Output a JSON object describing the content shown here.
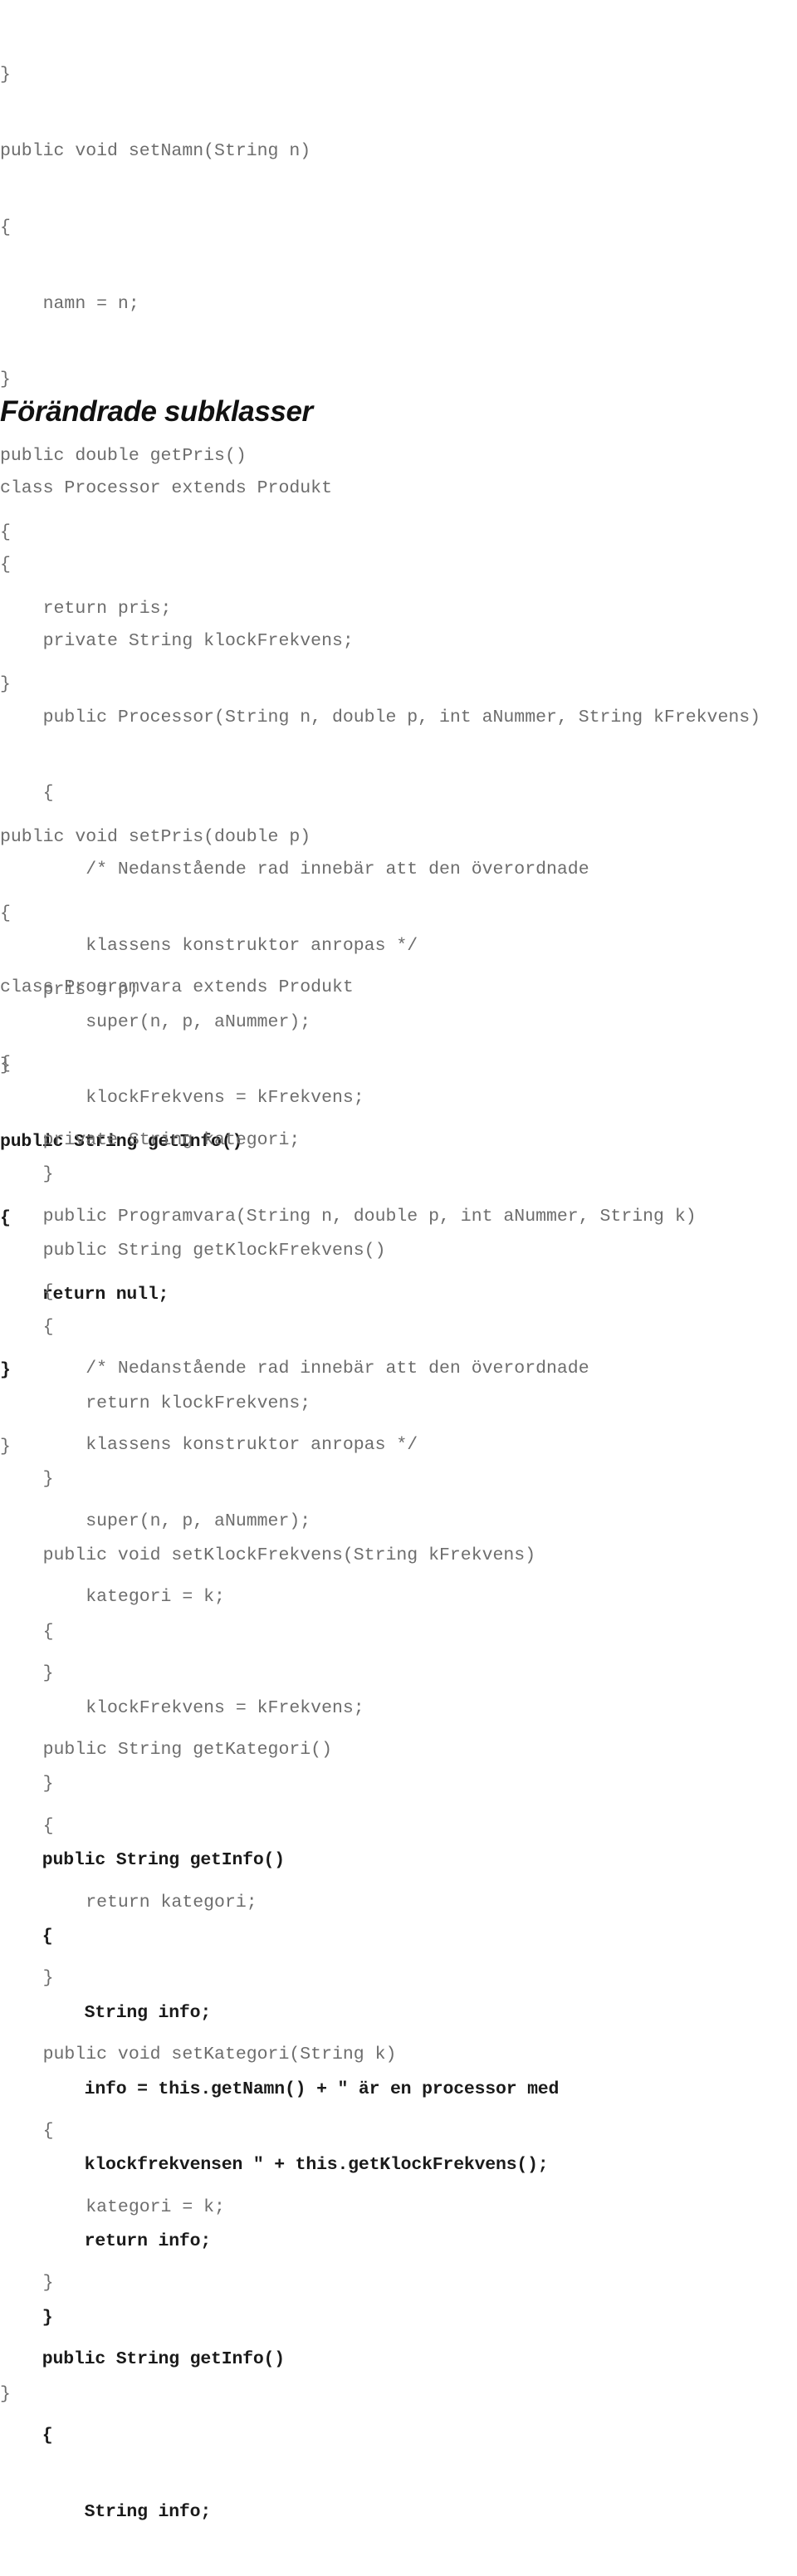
{
  "document": {
    "language": "sv",
    "kind": "java-code-listing"
  },
  "top_block": {
    "name": "produkt-class-tail",
    "lines": [
      {
        "text": "}",
        "bold": false
      },
      {
        "text": "public void setNamn(String n)",
        "bold": false
      },
      {
        "text": "{",
        "bold": false
      },
      {
        "text": "    namn = n;",
        "bold": false
      },
      {
        "text": "}",
        "bold": false
      },
      {
        "text": "public double getPris()",
        "bold": false
      },
      {
        "text": "{",
        "bold": false
      },
      {
        "text": "    return pris;",
        "bold": false
      },
      {
        "text": "}",
        "bold": false
      },
      {
        "text": "",
        "bold": false
      },
      {
        "text": "public void setPris(double p)",
        "bold": false
      },
      {
        "text": "{",
        "bold": false
      },
      {
        "text": "    pris = p;",
        "bold": false
      },
      {
        "text": "}",
        "bold": false
      },
      {
        "text": "public String getInfo()",
        "bold": true
      },
      {
        "text": "{",
        "bold": true
      },
      {
        "text": "    return null;",
        "bold": true
      },
      {
        "text": "}",
        "bold": true
      }
    ],
    "closing_brace": "}"
  },
  "heading": {
    "text": "Förändrade subklasser"
  },
  "processor_block": {
    "name": "processor-class",
    "lines": [
      {
        "text": "class Processor extends Produkt",
        "bold": false
      },
      {
        "text": "{",
        "bold": false
      },
      {
        "text": "    private String klockFrekvens;",
        "bold": false
      },
      {
        "text": "    public Processor(String n, double p, int aNummer, String kFrekvens)",
        "bold": false
      },
      {
        "text": "    {",
        "bold": false
      },
      {
        "text": "        /* Nedanstående rad innebär att den överordnade",
        "bold": false
      },
      {
        "text": "        klassens konstruktor anropas */",
        "bold": false
      },
      {
        "text": "        super(n, p, aNummer);",
        "bold": false
      },
      {
        "text": "        klockFrekvens = kFrekvens;",
        "bold": false
      },
      {
        "text": "    }",
        "bold": false
      },
      {
        "text": "    public String getKlockFrekvens()",
        "bold": false
      },
      {
        "text": "    {",
        "bold": false
      },
      {
        "text": "        return klockFrekvens;",
        "bold": false
      },
      {
        "text": "    }",
        "bold": false
      },
      {
        "text": "    public void setKlockFrekvens(String kFrekvens)",
        "bold": false
      },
      {
        "text": "    {",
        "bold": false
      },
      {
        "text": "        klockFrekvens = kFrekvens;",
        "bold": false
      },
      {
        "text": "    }",
        "bold": false
      },
      {
        "text": "    public String getInfo()",
        "bold": true
      },
      {
        "text": "    {",
        "bold": true
      },
      {
        "text": "        String info;",
        "bold": true
      },
      {
        "text": "        info = this.getNamn() + \" är en processor med",
        "bold": true
      },
      {
        "text": "        klockfrekvensen \" + this.getKlockFrekvens();",
        "bold": true
      },
      {
        "text": "        return info;",
        "bold": true
      },
      {
        "text": "    }",
        "bold": true
      },
      {
        "text": "}",
        "bold": false
      }
    ]
  },
  "programvara_block": {
    "name": "programvara-class",
    "lines": [
      {
        "text": "class Programvara extends Produkt",
        "bold": false
      },
      {
        "text": "{",
        "bold": false
      },
      {
        "text": "    private String kategori;",
        "bold": false
      },
      {
        "text": "    public Programvara(String n, double p, int aNummer, String k)",
        "bold": false
      },
      {
        "text": "    {",
        "bold": false
      },
      {
        "text": "        /* Nedanstående rad innebär att den överordnade",
        "bold": false
      },
      {
        "text": "        klassens konstruktor anropas */",
        "bold": false
      },
      {
        "text": "        super(n, p, aNummer);",
        "bold": false
      },
      {
        "text": "        kategori = k;",
        "bold": false
      },
      {
        "text": "    }",
        "bold": false
      },
      {
        "text": "    public String getKategori()",
        "bold": false
      },
      {
        "text": "    {",
        "bold": false
      },
      {
        "text": "        return kategori;",
        "bold": false
      },
      {
        "text": "    }",
        "bold": false
      },
      {
        "text": "    public void setKategori(String k)",
        "bold": false
      },
      {
        "text": "    {",
        "bold": false
      },
      {
        "text": "        kategori = k;",
        "bold": false
      },
      {
        "text": "    }",
        "bold": false
      },
      {
        "text": "    public String getInfo()",
        "bold": true
      },
      {
        "text": "    {",
        "bold": true
      },
      {
        "text": "        String info;",
        "bold": true
      }
    ]
  }
}
